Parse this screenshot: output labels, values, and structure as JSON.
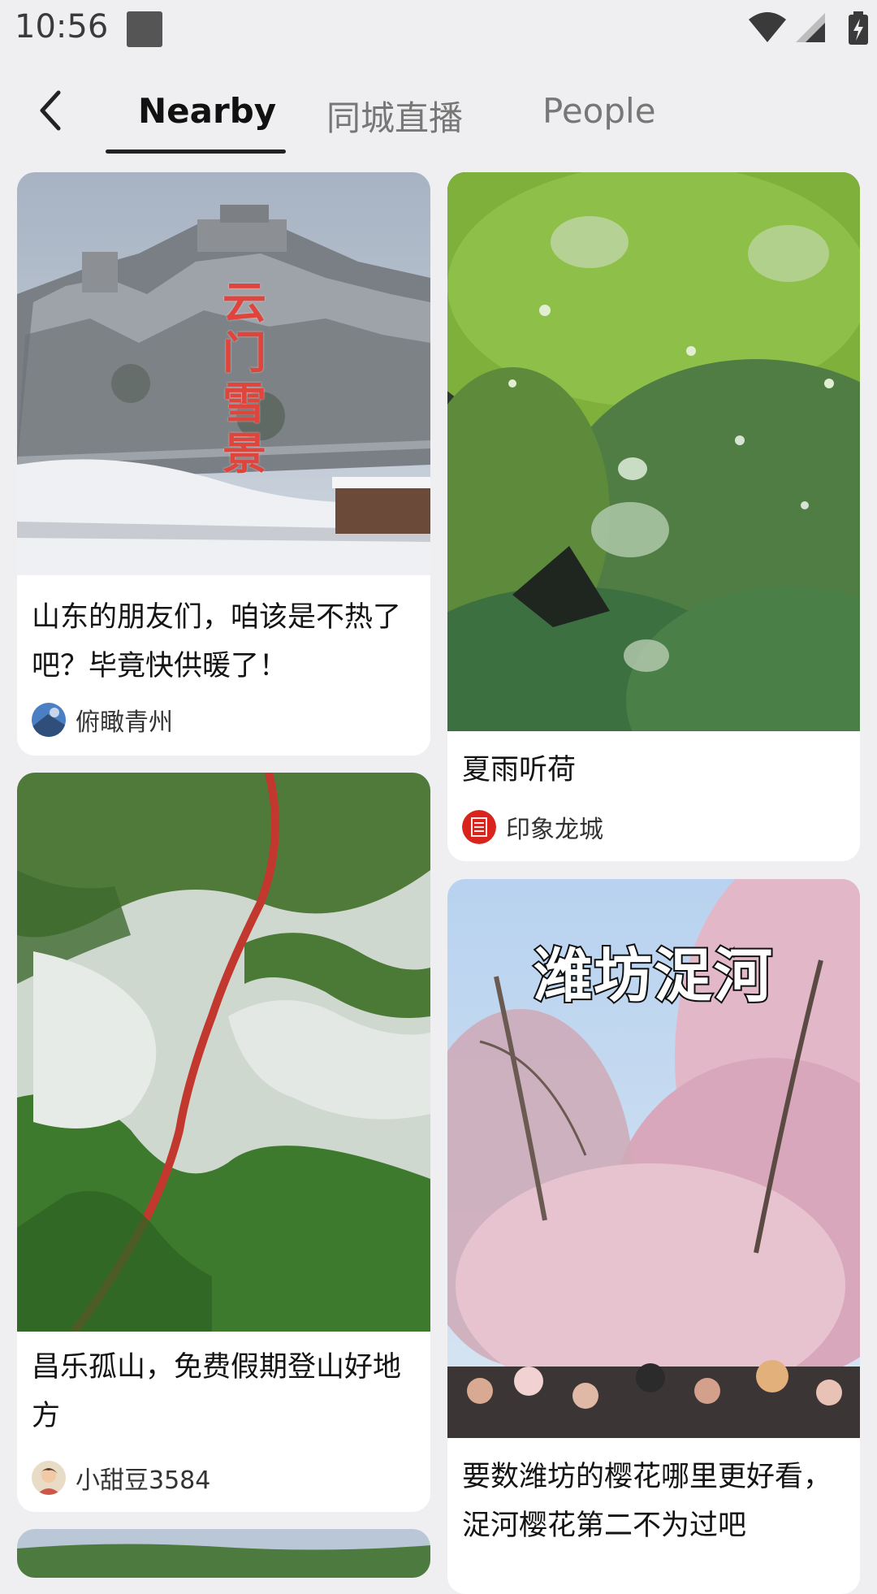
{
  "status_bar": {
    "time": "10:56",
    "icons": [
      "notification-square-icon",
      "wifi-icon",
      "signal-icon",
      "battery-charging-icon"
    ]
  },
  "nav": {
    "back_icon": "chevron-left-icon",
    "tabs": [
      {
        "label": "Nearby",
        "active": true
      },
      {
        "label": "同城直播",
        "active": false
      },
      {
        "label": "People",
        "active": false
      }
    ]
  },
  "feed": {
    "left": [
      {
        "image_overlay": "云门雪景",
        "title": "山东的朋友们，咱该是不热了吧？毕竟快供暖了！",
        "author": "俯瞰青州"
      },
      {
        "image_overlay": "",
        "title": "昌乐孤山，免费假期登山好地方",
        "author": "小甜豆3584"
      }
    ],
    "right": [
      {
        "image_overlay": "",
        "title": "夏雨听荷",
        "author": "印象龙城"
      },
      {
        "image_overlay": "潍坊浞河",
        "title": "要数潍坊的樱花哪里更好看，浞河樱花第二不为过吧",
        "author": ""
      }
    ]
  },
  "colors": {
    "background": "#efeff1",
    "card": "#ffffff",
    "active_tab": "#111111",
    "inactive_tab": "#777777",
    "overlay_red": "#e0453d"
  }
}
